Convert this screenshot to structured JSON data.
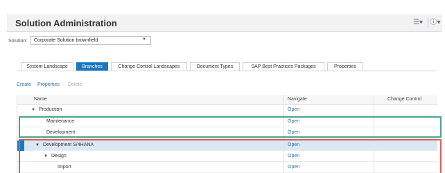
{
  "header": {
    "title": "Solution Administration",
    "icons": [
      "list-menu-icon",
      "help-icon"
    ]
  },
  "solution": {
    "label": "Solution:",
    "value": "Corporate Solution brownfield"
  },
  "tabs": [
    {
      "label": "System Landscape",
      "active": false
    },
    {
      "label": "Branches",
      "active": true
    },
    {
      "label": "Change Control Landscapes",
      "active": false
    },
    {
      "label": "Document Types",
      "active": false
    },
    {
      "label": "SAP Best Practices Packages",
      "active": false
    },
    {
      "label": "Properties",
      "active": false
    }
  ],
  "toolbar": {
    "create": "Create",
    "properties": "Properties",
    "delete": "Delete"
  },
  "table": {
    "columns": [
      "Name",
      "Navigate",
      "Change Control"
    ],
    "rows": [
      {
        "name": "Production",
        "navigate": "Open",
        "expanded": true,
        "level": 0,
        "selected": false
      },
      {
        "name": "Maintenance",
        "navigate": "Open",
        "level": 1,
        "selected": false
      },
      {
        "name": "Development",
        "navigate": "Open",
        "level": 1,
        "selected": false
      },
      {
        "name": "Development S/4HANA",
        "navigate": "Open",
        "expanded": true,
        "level": 1,
        "selected": true
      },
      {
        "name": "Design",
        "navigate": "Open",
        "expanded": true,
        "level": 2,
        "selected": false
      },
      {
        "name": "Import",
        "navigate": "Open",
        "level": 3,
        "selected": false
      }
    ]
  },
  "colors": {
    "accent": "#1a78c2",
    "link": "#2a6fa8",
    "highlight_green": "#4aa58a",
    "highlight_red": "#e05a5a",
    "selected_row": "#dbe8f4"
  }
}
